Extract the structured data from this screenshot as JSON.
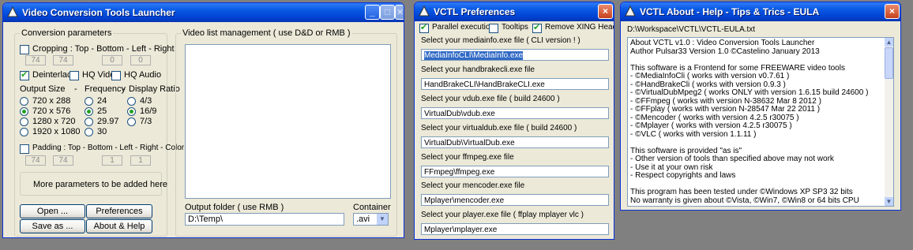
{
  "launcher": {
    "title": "Video Conversion Tools Launcher",
    "conversion_group": "Conversion parameters",
    "cropping_label": "Cropping  :  Top  -  Bottom  -  Left  -  Right",
    "crop_values": [
      "74",
      "74",
      "0",
      "0"
    ],
    "deinterlace": "Deinterlace",
    "hq_video": "HQ Video",
    "hq_audio": "HQ Audio",
    "size_header": "Output  Size",
    "freq_header": "Frequency",
    "ratio_header": "Display Ratio",
    "dot": "-",
    "sizes": [
      "720 x  288",
      "720 x  576",
      "1280 x  720",
      "1920 x 1080"
    ],
    "freqs": [
      "24",
      "25",
      "29.97",
      "30"
    ],
    "ratios": [
      "4/3",
      "16/9",
      "7/3"
    ],
    "padding_label": "Padding : Top - Bottom - Left - Right - Color",
    "pad_values": [
      "74",
      "74",
      "1",
      "1"
    ],
    "more_params": "More parameters to be added here",
    "open_btn": "Open ...",
    "prefs_btn": "Preferences",
    "saveas_btn": "Save as ...",
    "about_btn": "About & Help",
    "video_group": "Video list management ( use D&D or RMB )",
    "output_label": "Output folder ( use RMB )",
    "output_value": "D:\\Temp\\",
    "container_label": "Container",
    "container_value": ".avi"
  },
  "prefs": {
    "title": "VCTL Preferences",
    "parallel": "Parallel execution",
    "tooltips": "Tooltips",
    "remove_xing": "Remove XING Header",
    "items": [
      {
        "label": "Select your mediainfo.exe file ( CLI version ! )",
        "value": "MediaInfoCLI\\MediaInfo.exe"
      },
      {
        "label": "Select your handbrakecli.exe file",
        "value": "HandBrakeCLI\\HandBrakeCLI.exe"
      },
      {
        "label": "Select your vdub.exe file ( build 24600 )",
        "value": "VirtualDub\\vdub.exe"
      },
      {
        "label": "Select your virtualdub.exe file ( build 24600 )",
        "value": "VirtualDub\\VirtualDub.exe"
      },
      {
        "label": "Select your ffmpeg.exe file",
        "value": "FFmpeg\\ffmpeg.exe"
      },
      {
        "label": "Select your mencoder.exe file",
        "value": "Mplayer\\mencoder.exe"
      },
      {
        "label": "Select your player.exe file ( ffplay mplayer vlc )",
        "value": "Mplayer\\mplayer.exe"
      }
    ]
  },
  "about": {
    "title": "VCTL About - Help - Tips & Trics - EULA",
    "path": "D:\\Workspace\\VCTL\\VCTL-EULA.txt",
    "lines": [
      "About VCTL v1.0 : Video Conversion Tools Launcher",
      "Author Pulsar33 Version 1.0 ©Castelino January 2013",
      "",
      "This software is a Frontend for some FREEWARE video tools",
      "- ©MediaInfoCli ( works with version v0.7.61 )",
      "- ©HandBrakeCli ( works with version 0.9.3 )",
      "- ©VirtualDubMpeg2 ( works ONLY with version 1.6.15 build 24600 )",
      "- ©FFmpeg   ( works with version N-38632 Mar 8 2012 )",
      "- ©FFplay   ( works with version N-28547 Mar 22 2011 )",
      "- ©Mencoder ( works with version 4.2.5 r30075 )",
      "- ©Mplayer  ( works with version 4.2.5 r30075 )",
      "- ©VLC      ( works with version 1.1.11 )",
      "",
      "This software is provided \"as is\"",
      "- Other version of tools than specified above may not work",
      "- Use it at your own risk",
      "- Respect copyrights and laws",
      "",
      "This program has been tested under ©Windows XP SP3 32 bits",
      "No warranty is given about ©Vista, ©Win7, ©Win8 or 64 bits CPU"
    ]
  },
  "colors": {
    "desktop": "#808080",
    "titlebar": "#0A5AE6",
    "window": "#ECE9D8",
    "selection": "#316AC5"
  }
}
